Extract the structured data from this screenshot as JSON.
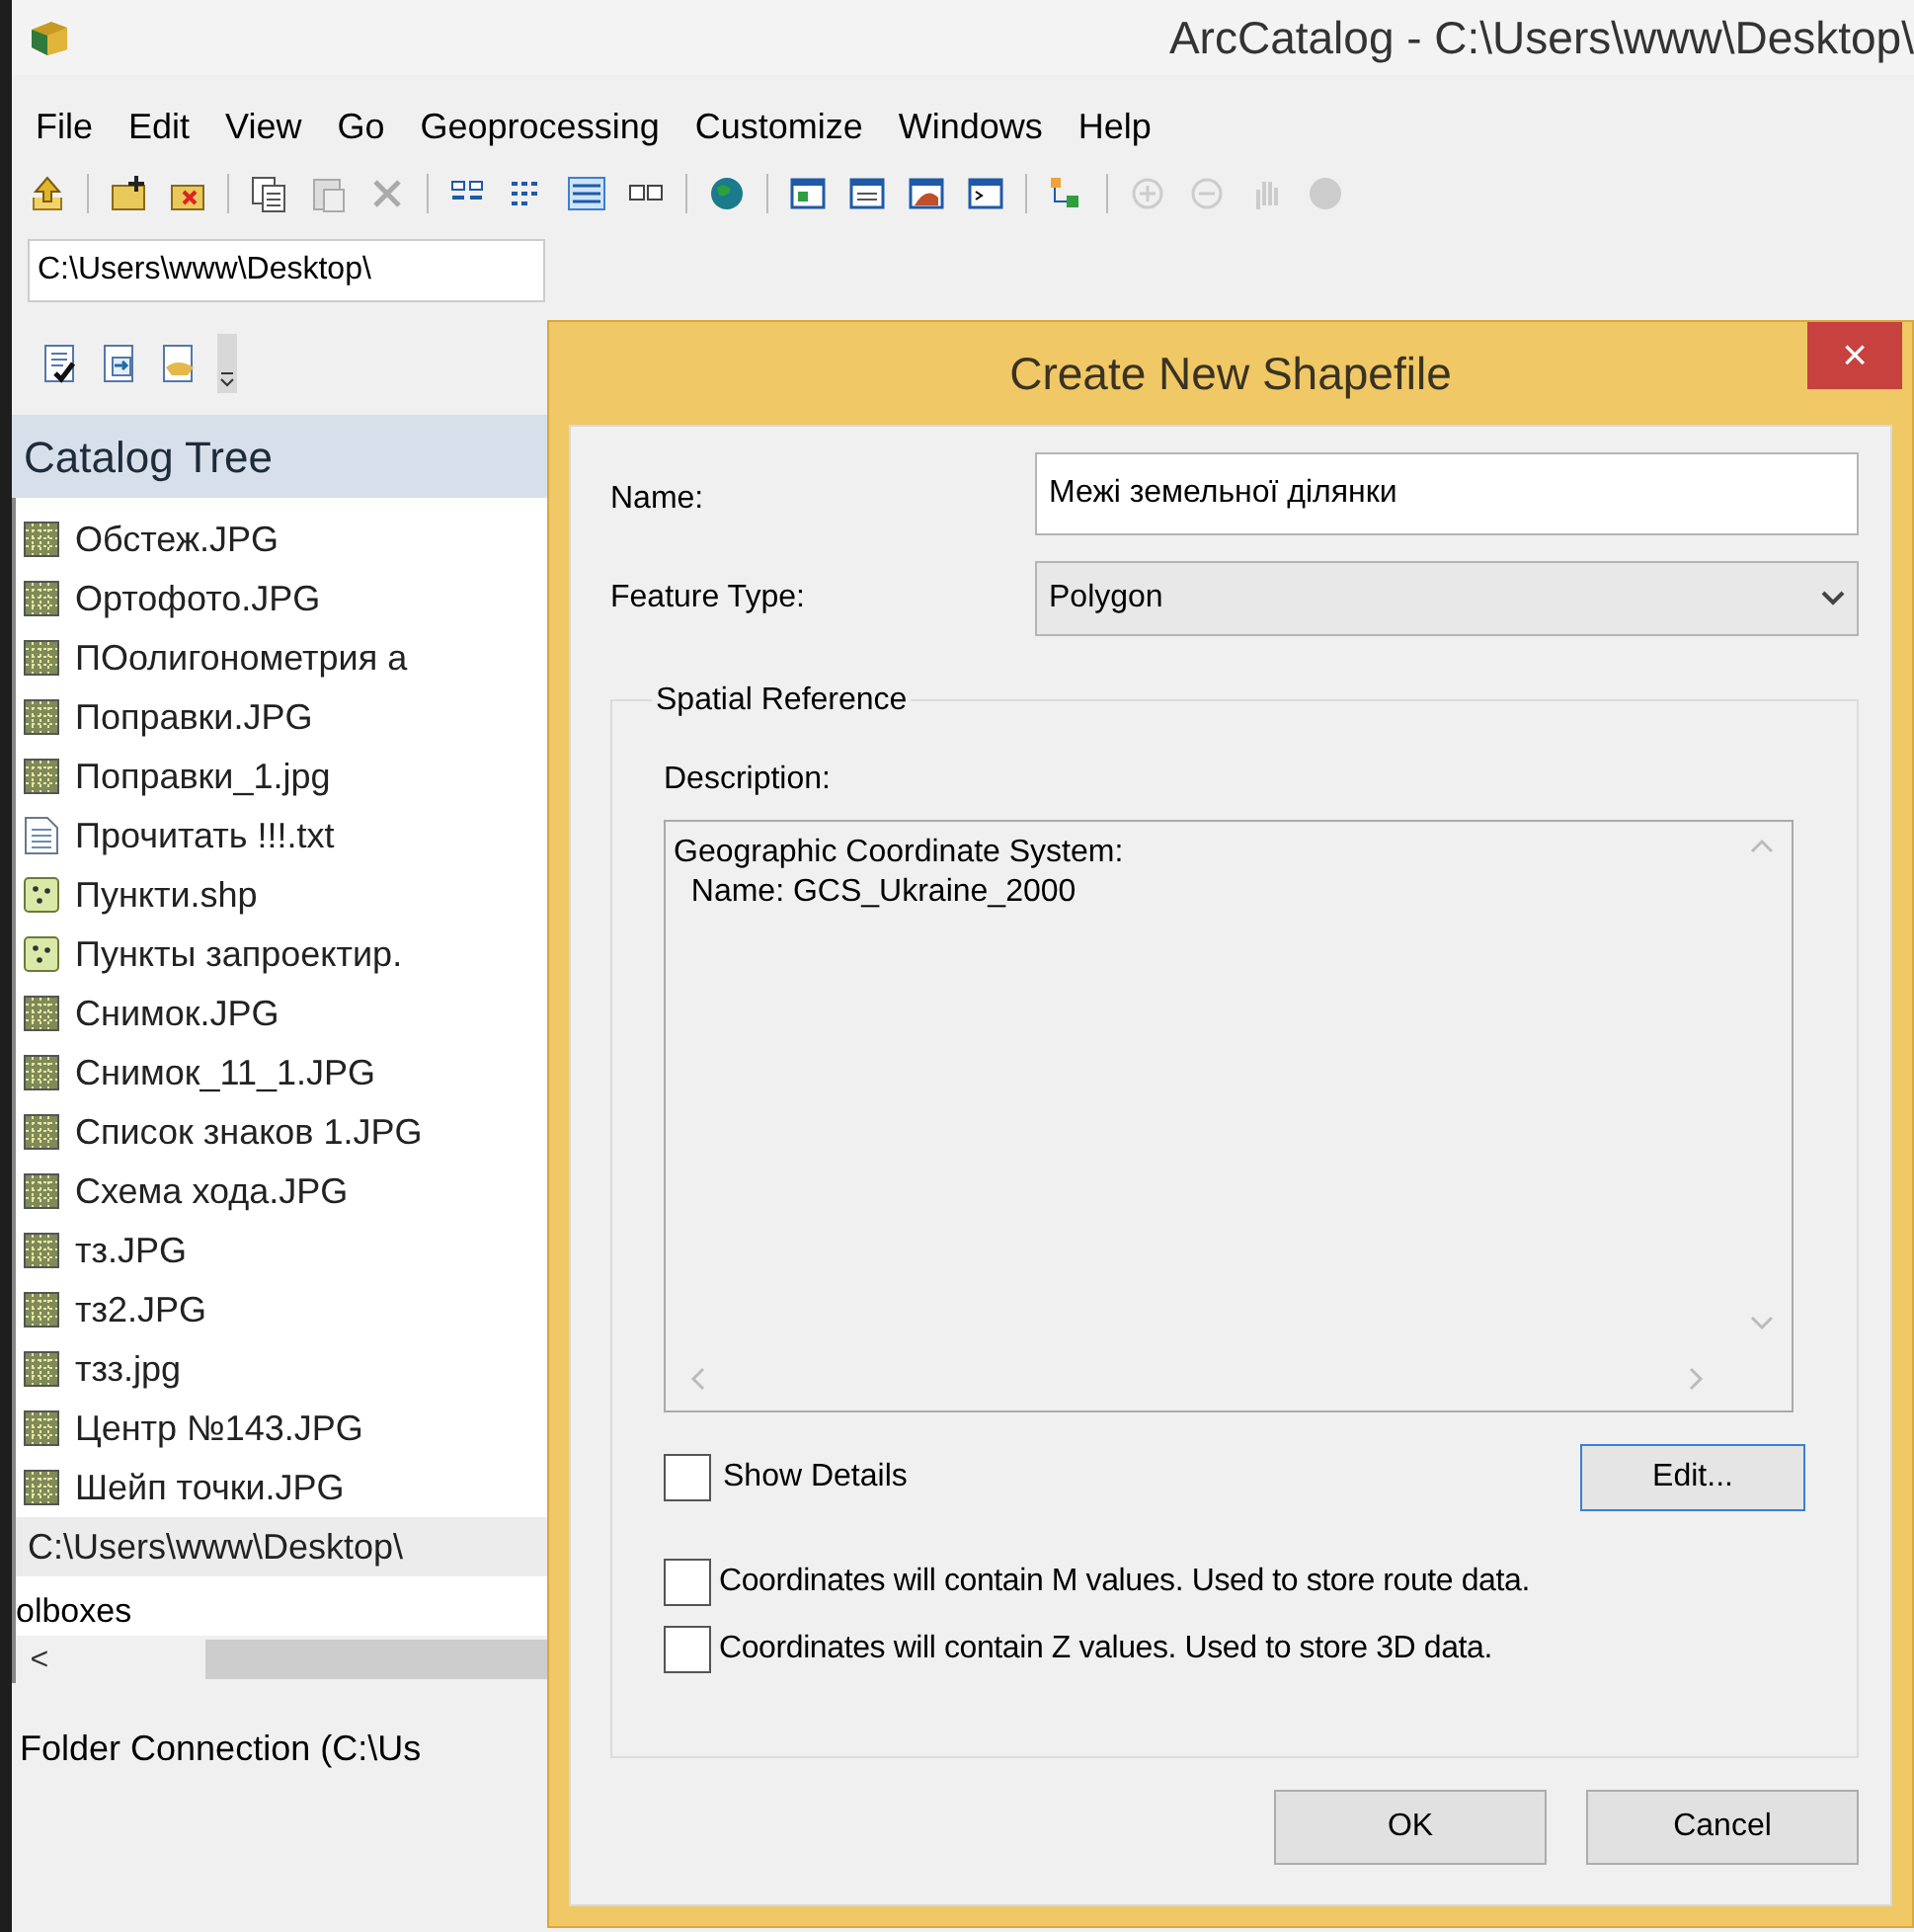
{
  "window": {
    "title": "ArcCatalog - C:\\Users\\www\\Desktop\\"
  },
  "menu": [
    "File",
    "Edit",
    "View",
    "Go",
    "Geoprocessing",
    "Customize",
    "Windows",
    "Help"
  ],
  "address": {
    "value": "C:\\Users\\www\\Desktop\\"
  },
  "catalog_tree": {
    "title": "Catalog Tree",
    "items": [
      {
        "label": "Обстеж.JPG",
        "kind": "raster"
      },
      {
        "label": "Ортофото.JPG",
        "kind": "raster"
      },
      {
        "label": "ПОолигонометрия а",
        "kind": "raster"
      },
      {
        "label": "Поправки.JPG",
        "kind": "raster"
      },
      {
        "label": "Поправки_1.jpg",
        "kind": "raster"
      },
      {
        "label": "Прочитать !!!.txt",
        "kind": "text"
      },
      {
        "label": "Пункти.shp",
        "kind": "shapefile"
      },
      {
        "label": "Пункты запроектир.",
        "kind": "shapefile"
      },
      {
        "label": "Снимок.JPG",
        "kind": "raster"
      },
      {
        "label": "Снимок_11_1.JPG",
        "kind": "raster"
      },
      {
        "label": "Список знаков 1.JPG",
        "kind": "raster"
      },
      {
        "label": "Схема хода.JPG",
        "kind": "raster"
      },
      {
        "label": "тз.JPG",
        "kind": "raster"
      },
      {
        "label": "тз2.JPG",
        "kind": "raster"
      },
      {
        "label": "тзз.jpg",
        "kind": "raster"
      },
      {
        "label": "Центр №143.JPG",
        "kind": "raster"
      },
      {
        "label": "Шейп точки.JPG",
        "kind": "raster"
      }
    ],
    "path": "C:\\Users\\www\\Desktop\\",
    "toolbox_text": "olboxes",
    "scroll_left": "<"
  },
  "status_bar": "Folder Connection (C:\\Us",
  "dialog": {
    "title": "Create New Shapefile",
    "close": "×",
    "name_label": "Name:",
    "name_value": "Межі земельної ділянки",
    "feature_type_label": "Feature Type:",
    "feature_type_value": "Polygon",
    "group_title": "Spatial Reference",
    "description_label": "Description:",
    "description_lines": [
      "Geographic Coordinate System:",
      "  Name: GCS_Ukraine_2000"
    ],
    "show_details": {
      "label": "Show Details",
      "checked": false
    },
    "edit_button": "Edit...",
    "options": [
      {
        "label": "Coordinates will contain M values. Used to store route data.",
        "checked": false
      },
      {
        "label": "Coordinates will contain Z values. Used to store 3D data.",
        "checked": false
      }
    ],
    "buttons": [
      "OK",
      "Cancel"
    ]
  }
}
